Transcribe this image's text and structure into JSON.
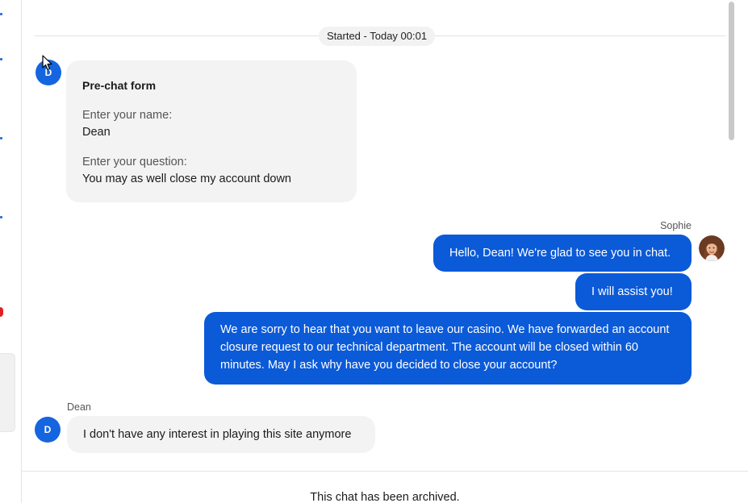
{
  "chat": {
    "started_label": "Started - Today 00:01",
    "visitor_initial": "D",
    "prechat": {
      "title": "Pre-chat form",
      "name_label": "Enter your name:",
      "name_value": "Dean",
      "question_label": "Enter your question:",
      "question_value": "You may as well close my account down"
    },
    "agent": {
      "name": "Sophie",
      "avatar_icon": "agent-avatar-photo",
      "messages": [
        "Hello, Dean! We're glad to see you in chat.",
        "I will assist you!",
        "We are sorry to hear that you want to leave our casino. We have forwarded an account closure request to our technical department. The account will be closed within 60 minutes. May I ask why have you decided to close your account?"
      ]
    },
    "visitor": {
      "name": "Dean",
      "messages": [
        "I don't have any interest in playing this site anymore"
      ]
    },
    "footer": "This chat has been archived."
  },
  "colors": {
    "accent": "#0b5ad8",
    "avatar": "#1565e0",
    "bubble_gray": "#f3f3f3"
  }
}
